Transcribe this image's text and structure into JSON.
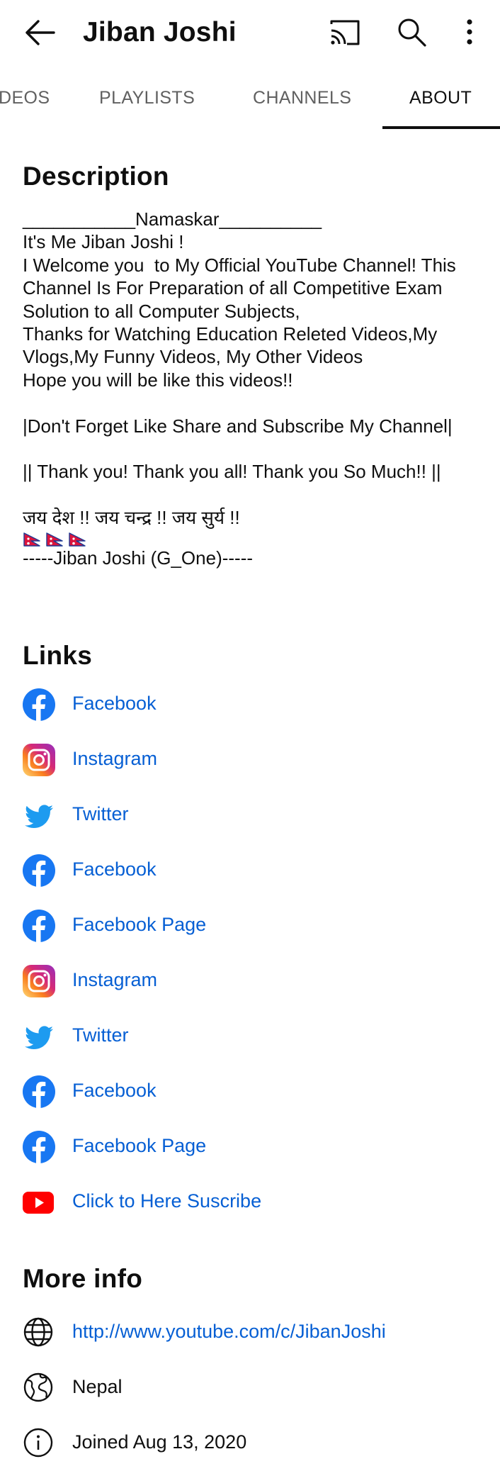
{
  "appbar": {
    "title": "Jiban Joshi"
  },
  "tabs": [
    "DEOS",
    "PLAYLISTS",
    "CHANNELS",
    "ABOUT"
  ],
  "description": {
    "heading": "Description",
    "lines": [
      "___________Namaskar__________",
      "It's Me Jiban Joshi !",
      "I Welcome you  to My Official YouTube Channel! This",
      "Channel Is For Preparation of all Competitive Exam",
      "Solution to all Computer Subjects,",
      "Thanks for Watching Education Releted Videos,My",
      "Vlogs,My Funny Videos, My Other Videos",
      "Hope you will be like this videos!!",
      "",
      "|Don't Forget Like Share and Subscribe My Channel|",
      "",
      "|| Thank you! Thank you all! Thank you So Much!! ||",
      "",
      "जय देश !! जय चन्द्र !! जय सुर्य !!"
    ],
    "signature": "-----Jiban Joshi (G_One)-----"
  },
  "links": {
    "heading": "Links",
    "items": [
      {
        "label": "Facebook",
        "icon": "facebook-icon"
      },
      {
        "label": "Instagram",
        "icon": "instagram-icon"
      },
      {
        "label": "Twitter",
        "icon": "twitter-icon"
      },
      {
        "label": "Facebook",
        "icon": "facebook-icon"
      },
      {
        "label": "Facebook Page",
        "icon": "facebook-icon"
      },
      {
        "label": "Instagram",
        "icon": "instagram-icon"
      },
      {
        "label": "Twitter",
        "icon": "twitter-icon"
      },
      {
        "label": "Facebook",
        "icon": "facebook-icon"
      },
      {
        "label": "Facebook Page",
        "icon": "facebook-icon"
      },
      {
        "label": "Click to Here Suscribe",
        "icon": "youtube-icon"
      }
    ]
  },
  "more_info": {
    "heading": "More info",
    "url": "http://www.youtube.com/c/JibanJoshi",
    "country": "Nepal",
    "joined": "Joined Aug 13, 2020"
  },
  "colors": {
    "link": "#065fd4",
    "facebook": "#1877f2",
    "twitter": "#1d9bf0",
    "youtube": "#ff0000",
    "flag_red": "#dc143c"
  }
}
